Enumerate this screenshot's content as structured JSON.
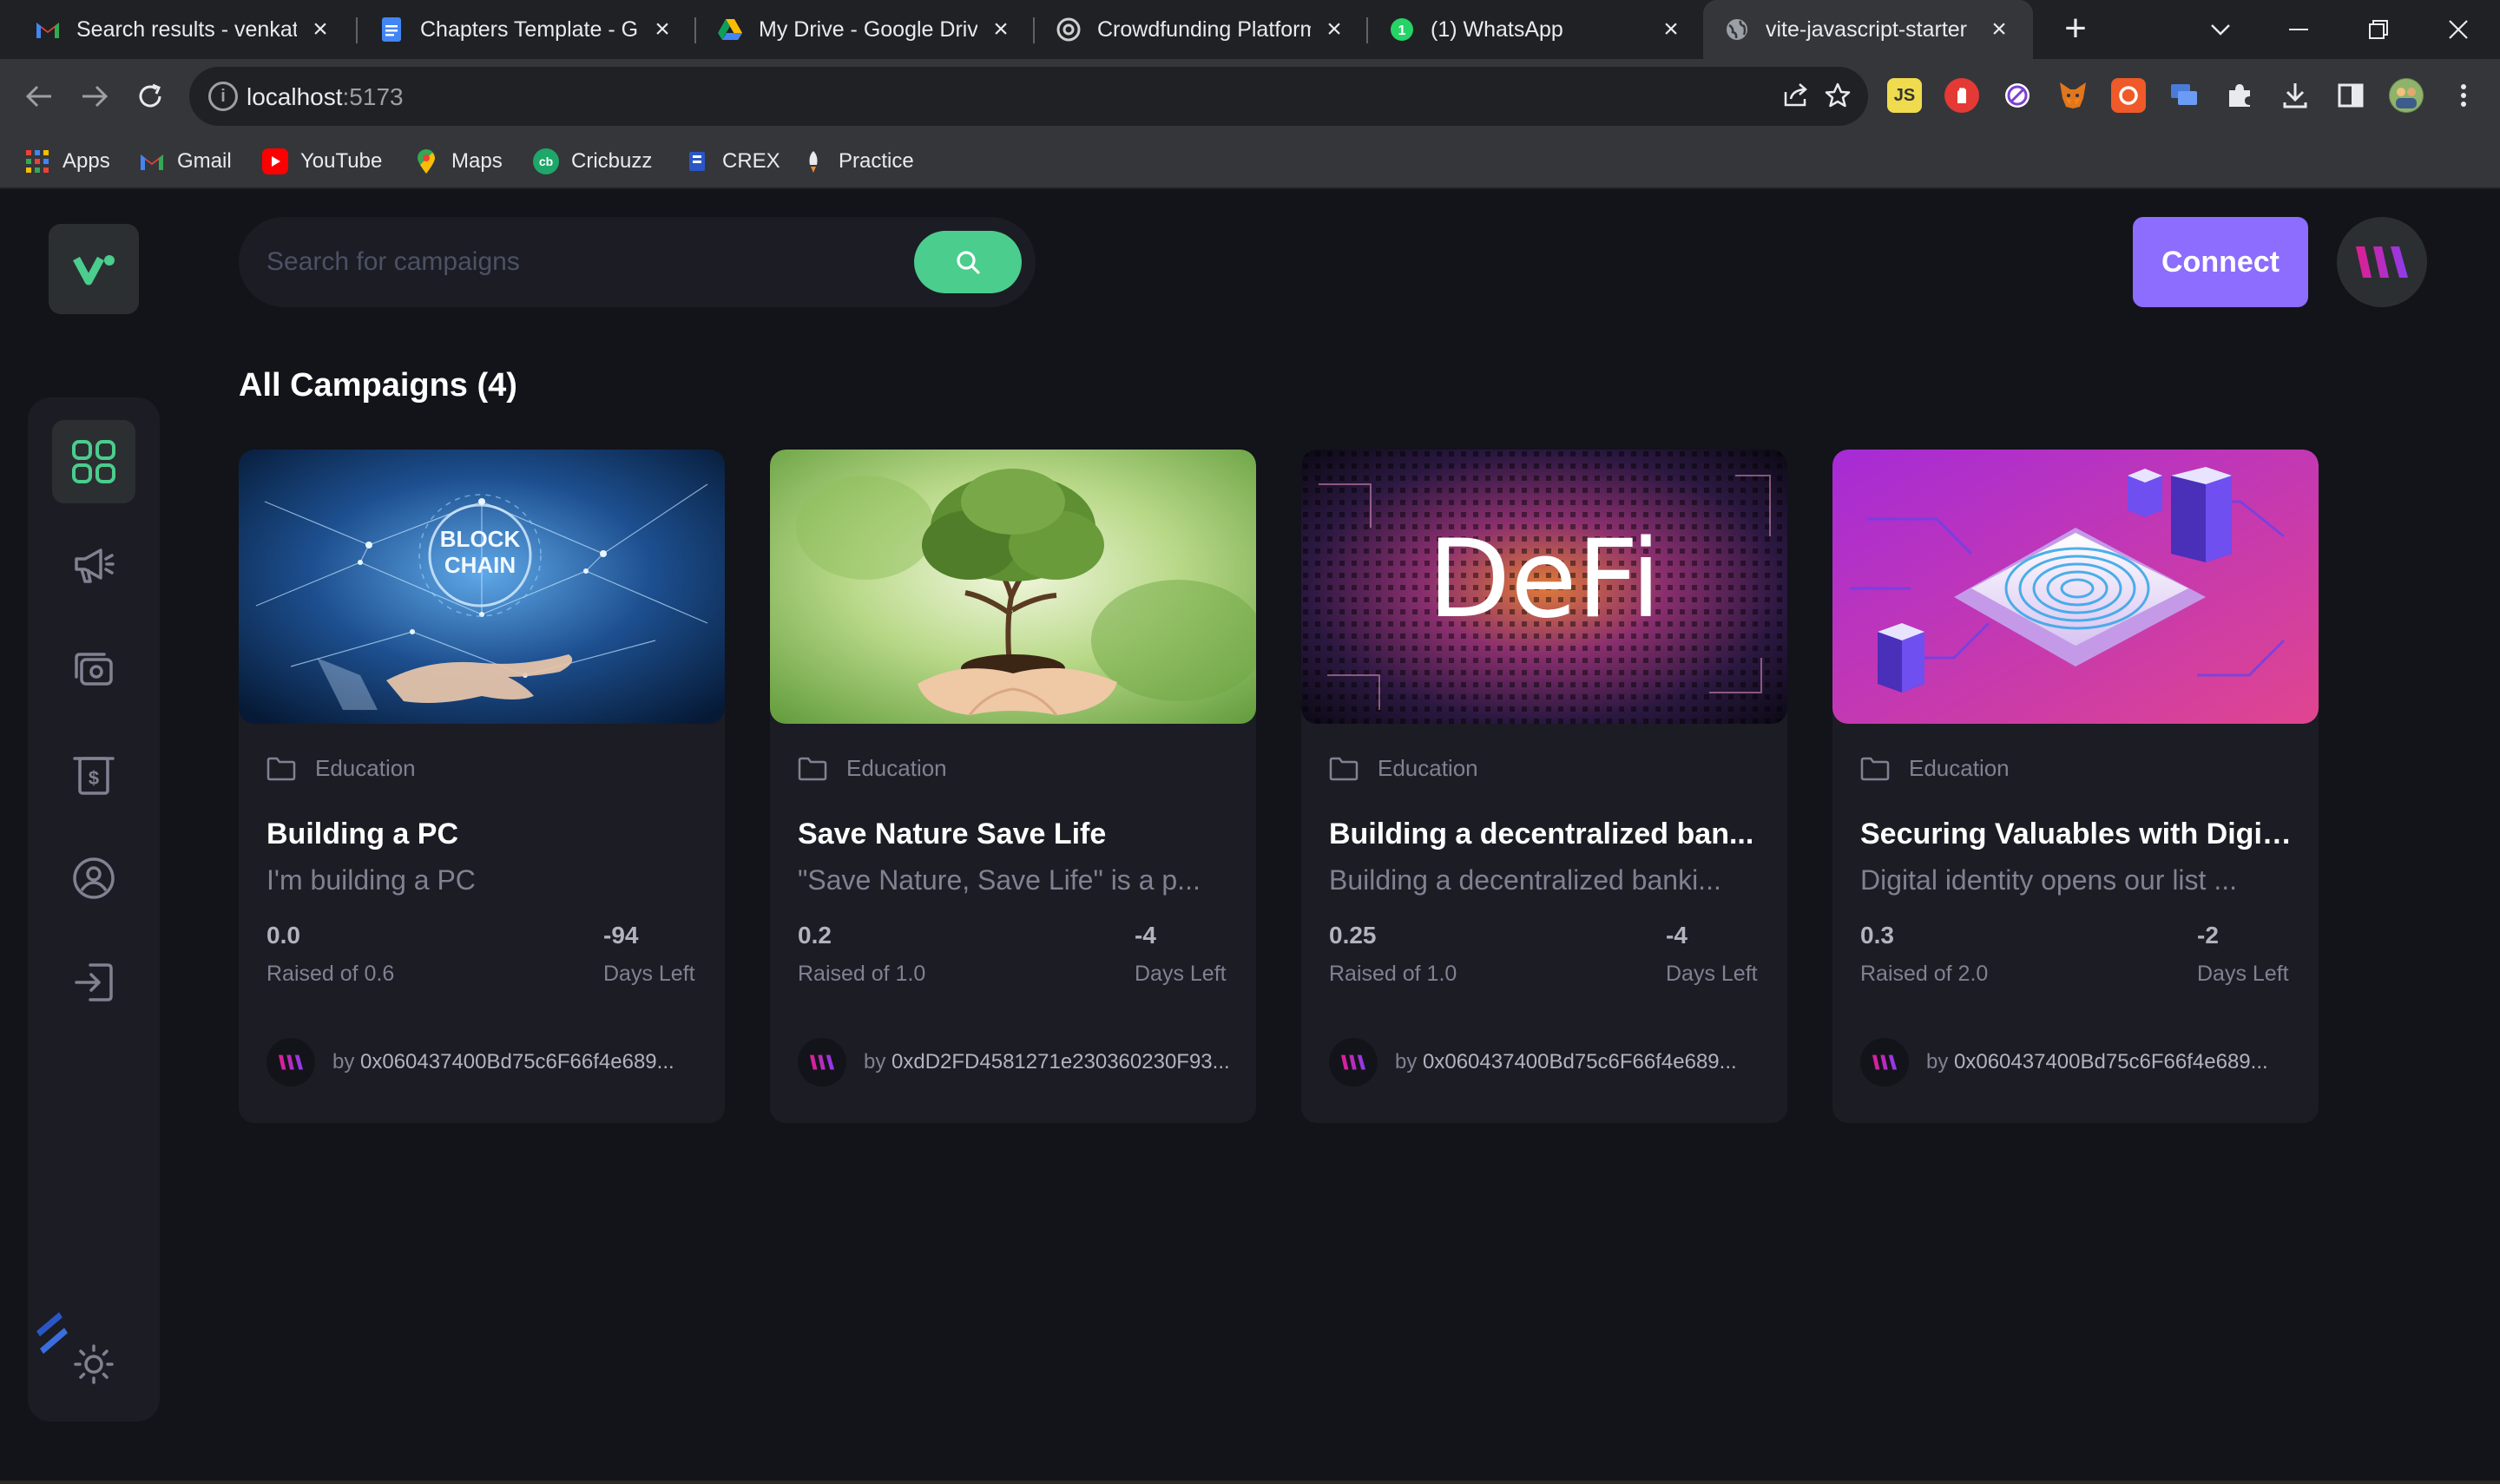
{
  "browser": {
    "tabs": [
      {
        "title": "Search results - venkatesh",
        "icon": "gmail-icon"
      },
      {
        "title": "Chapters Template - Google Docs",
        "icon": "docs-icon"
      },
      {
        "title": "My Drive - Google Drive",
        "icon": "drive-icon"
      },
      {
        "title": "Crowdfunding Platform ChatGPT",
        "icon": "chatgpt-icon"
      },
      {
        "title": "(1) WhatsApp",
        "icon": "whatsapp-icon"
      },
      {
        "title": "vite-javascript-starter",
        "icon": "globe-icon"
      }
    ],
    "url_host": "localhost",
    "url_port": ":5173",
    "bookmarks": [
      {
        "label": "Apps",
        "icon": "apps-grid-icon"
      },
      {
        "label": "Gmail",
        "icon": "gmail-icon"
      },
      {
        "label": "YouTube",
        "icon": "youtube-icon"
      },
      {
        "label": "Maps",
        "icon": "maps-icon"
      },
      {
        "label": "Cricbuzz",
        "icon": "cricbuzz-icon"
      },
      {
        "label": "CREX",
        "icon": "crex-icon"
      },
      {
        "label": "Practice",
        "icon": "practice-icon"
      }
    ],
    "extension_labels": {
      "js": "JS"
    }
  },
  "app": {
    "search_placeholder": "Search for campaigns",
    "connect_label": "Connect",
    "section_title": "All Campaigns (4)",
    "accent": "#4acd8d",
    "primary": "#8c6dfd",
    "campaigns": [
      {
        "category": "Education",
        "title": "Building a PC",
        "description": "I'm building a PC",
        "raised": "0.0",
        "raised_label": "Raised of 0.6",
        "days": "-94",
        "days_label": "Days Left",
        "owner_prefix": "by ",
        "owner": "0x060437400Bd75c6F66f4e689...",
        "image_text": "BLOCK CHAIN"
      },
      {
        "category": "Education",
        "title": "Save Nature Save Life",
        "description": "\"Save Nature, Save Life\" is a p...",
        "raised": "0.2",
        "raised_label": "Raised of 1.0",
        "days": "-4",
        "days_label": "Days Left",
        "owner_prefix": "by ",
        "owner": "0xdD2FD4581271e230360230F93..."
      },
      {
        "category": "Education",
        "title": "Building a decentralized ban...",
        "description": "Building a decentralized banki...",
        "raised": "0.25",
        "raised_label": "Raised of 1.0",
        "days": "-4",
        "days_label": "Days Left",
        "owner_prefix": "by ",
        "owner": "0x060437400Bd75c6F66f4e689...",
        "image_text": "DeFi"
      },
      {
        "category": "Education",
        "title": "Securing Valuables with Digit...",
        "description": "Digital identity opens our list ...",
        "raised": "0.3",
        "raised_label": "Raised of 2.0",
        "days": "-2",
        "days_label": "Days Left",
        "owner_prefix": "by ",
        "owner": "0x060437400Bd75c6F66f4e689..."
      }
    ],
    "sidebar_icons": [
      "dashboard-icon",
      "megaphone-icon",
      "payment-icon",
      "withdraw-icon",
      "profile-icon",
      "logout-icon"
    ],
    "theme_icon": "sun-icon"
  }
}
